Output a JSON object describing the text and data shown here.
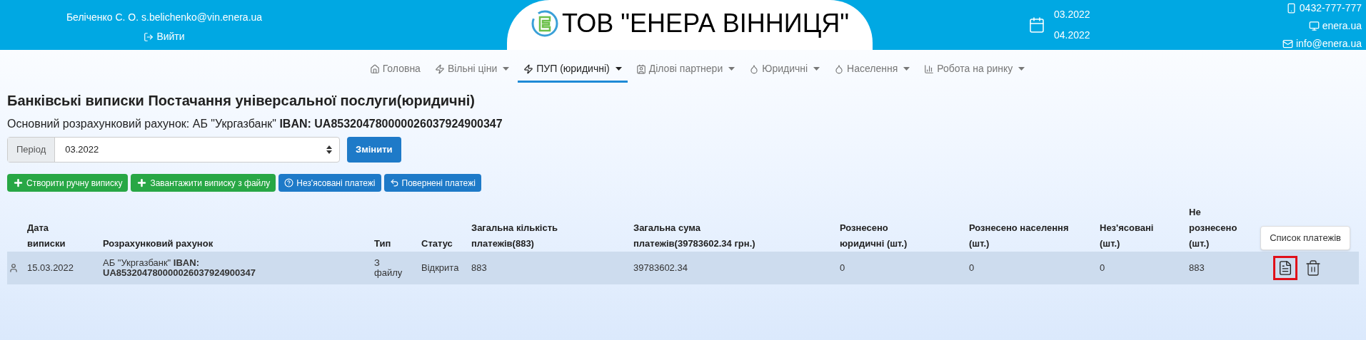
{
  "header": {
    "user": "Беліченко С. О. s.belichenko@vin.enera.ua",
    "logout": "Вийти",
    "company": "ТОВ \"ЕНЕРА ВІННИЦЯ\"",
    "periods": [
      "03.2022",
      "04.2022"
    ],
    "phone": "0432-777-777",
    "site": "enera.ua",
    "email": "info@enera.ua"
  },
  "nav": [
    {
      "label": "Головна",
      "kind": "home",
      "dropdown": false,
      "selected": false
    },
    {
      "label": "Вільні ціни",
      "kind": "bolt",
      "dropdown": true,
      "selected": false
    },
    {
      "label": "ПУП (юридичні)",
      "kind": "bolt",
      "dropdown": true,
      "selected": true
    },
    {
      "label": "Ділові партнери",
      "kind": "badge",
      "dropdown": true,
      "selected": false
    },
    {
      "label": "Юридичні",
      "kind": "drop",
      "dropdown": true,
      "selected": false
    },
    {
      "label": "Населення",
      "kind": "drop",
      "dropdown": true,
      "selected": false
    },
    {
      "label": "Робота на ринку",
      "kind": "chart",
      "dropdown": true,
      "selected": false
    }
  ],
  "title": "Банківські виписки Постачання універсальної послуги(юридичні)",
  "account_line": "Основний розрахунковий рахунок: АБ \"Укргазбанк\" **IBAN: UA853204780000026037924900347**",
  "period": {
    "label": "Період",
    "value": "03.2022",
    "button": "Змінити"
  },
  "actions": [
    {
      "label": "Створити ручну виписку",
      "kind": "plus",
      "color": "#28a745"
    },
    {
      "label": "Завантажити виписку з файлу",
      "kind": "plus",
      "color": "#28a745"
    },
    {
      "label": "Нез'ясовані платежі",
      "kind": "question",
      "color": "#1e7ac8"
    },
    {
      "label": "Повернені платежі",
      "kind": "undo",
      "color": "#1e7ac8"
    }
  ],
  "table": {
    "columns": [
      "Дата виписки",
      "Розрахунковий рахунок",
      "Тип",
      "Статус",
      "Загальна кількість платежів(883)",
      "Загальна сума платежів(39783602.34 грн.)",
      "Рознесено юридичні (шт.)",
      "Рознесено населення (шт.)",
      "Нез'ясовані (шт.)",
      "Не рознесено (шт.)"
    ],
    "rows": [
      {
        "cells": [
          "15.03.2022",
          "АБ \"Укргазбанк\" **IBAN: UA853204780000026037924900347**",
          "З файлу",
          "Відкрита",
          "883",
          "39783602.34",
          "0",
          "0",
          "0",
          "883"
        ]
      }
    ]
  },
  "tooltip": "Список платежів"
}
